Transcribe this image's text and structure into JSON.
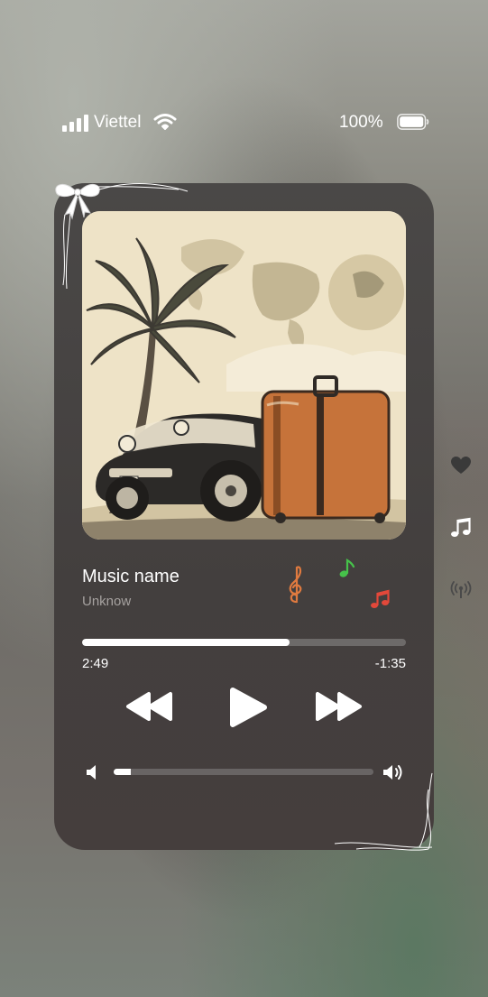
{
  "status_bar": {
    "carrier": "Viettel",
    "battery_percent": "100%",
    "signal_bars": 4,
    "icons": [
      "signal-icon",
      "wifi-icon",
      "battery-icon"
    ]
  },
  "player": {
    "track_title": "Music name",
    "artist": "Unknow",
    "time_elapsed": "2:49",
    "time_remaining": "-1:35",
    "progress_fraction": 0.64,
    "volume_fraction": 0.065,
    "controls": [
      "rewind-icon",
      "play-icon",
      "fast-forward-icon"
    ],
    "volume_icons": [
      "volume-low-icon",
      "volume-high-icon"
    ],
    "note_colors": {
      "treble_clef": "#e07a3f",
      "eighth_note": "#46c24a",
      "beamed_notes": "#e2483a"
    }
  },
  "side_actions": [
    "heart-icon",
    "music-note-icon",
    "broadcast-icon"
  ],
  "artwork": {
    "description_icon": "album-art-icon"
  }
}
